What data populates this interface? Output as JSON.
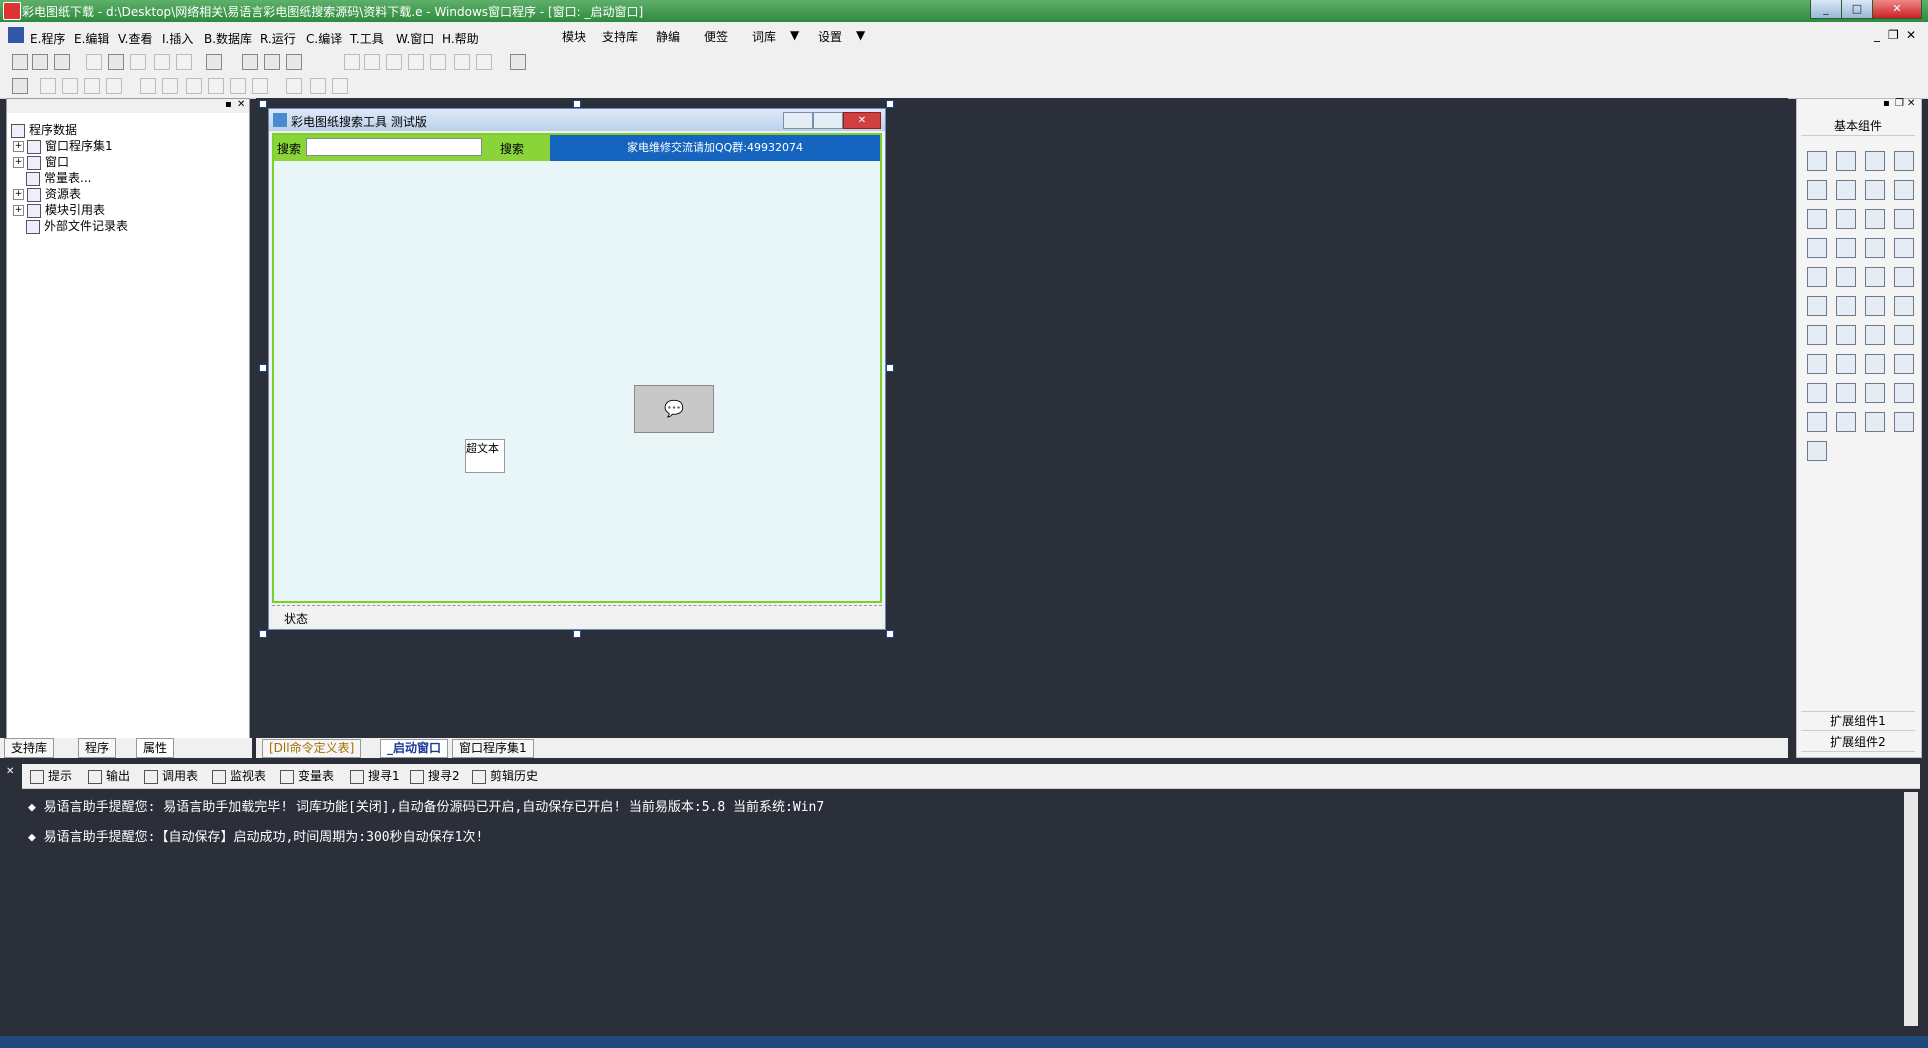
{
  "window": {
    "title": "彩电图纸下载 - d:\\Desktop\\网络相关\\易语言彩电图纸搜索源码\\资料下载.e - Windows窗口程序 - [窗口: _启动窗口]"
  },
  "menu": {
    "items": [
      "E.程序",
      "E.编辑",
      "V.查看",
      "I.插入",
      "B.数据库",
      "R.运行",
      "C.编译",
      "T.工具",
      "W.窗口",
      "H.帮助"
    ],
    "extras": [
      "模块",
      "支持库",
      "静编",
      "便签",
      "词库",
      "设置"
    ]
  },
  "tree": {
    "root": "程序数据",
    "items": [
      "窗口程序集1",
      "窗口",
      "常量表...",
      "资源表",
      "模块引用表",
      "外部文件记录表"
    ]
  },
  "left_tabs": [
    "支持库",
    "程序",
    "属性"
  ],
  "form": {
    "title": "彩电图纸搜索工具 测试版",
    "search_label": "搜索",
    "search_value": "",
    "search_button": "搜索",
    "banner": "家电维修交流请加QQ群:49932074",
    "richtext_label": "超文本",
    "status_label": "状态"
  },
  "palette": {
    "title": "基本组件",
    "ext1": "扩展组件1",
    "ext2": "扩展组件2"
  },
  "doc_tabs": [
    "[Dll命令定义表]",
    "_启动窗口",
    "窗口程序集1"
  ],
  "output_tabs": [
    "提示",
    "输出",
    "调用表",
    "监视表",
    "变量表",
    "搜寻1",
    "搜寻2",
    "剪辑历史"
  ],
  "output_lines": [
    "易语言助手提醒您:  易语言助手加载完毕!  词库功能[关闭],自动备份源码已开启,自动保存已开启!  当前易版本:5.8  当前系统:Win7",
    "易语言助手提醒您:【自动保存】启动成功,时间周期为:300秒自动保存1次!"
  ],
  "colors": {
    "title_green": "#2e8a3e",
    "form_green": "#8ad43a",
    "banner_blue": "#1565c0",
    "ide_bg": "#2b2f3a"
  }
}
